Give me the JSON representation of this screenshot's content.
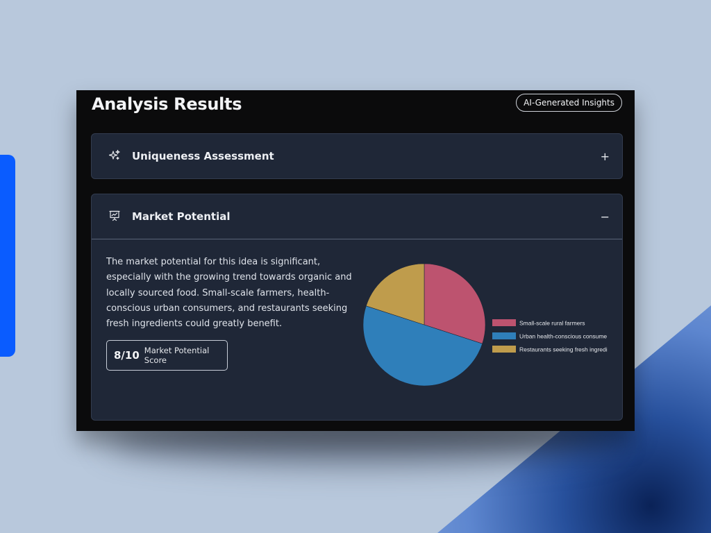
{
  "header": {
    "title": "Analysis Results",
    "badge": "AI-Generated Insights"
  },
  "sections": [
    {
      "title": "Uniqueness Assessment",
      "icon": "sparkles-icon",
      "toggle": "+",
      "expanded": false
    },
    {
      "title": "Market Potential",
      "icon": "presentation-chart-icon",
      "toggle": "−",
      "expanded": true,
      "description": "The market potential for this idea is significant, especially with the growing trend towards organic and locally sourced food. Small-scale farmers, health-conscious urban consumers, and restaurants seeking fresh ingredients could greatly benefit.",
      "score_value": "8/10",
      "score_label": "Market Potential Score"
    }
  ],
  "chart_data": {
    "type": "pie",
    "categories": [
      "Small-scale rural farmers",
      "Urban health-conscious consume",
      "Restaurants seeking fresh ingredi"
    ],
    "values": [
      30,
      50,
      20
    ],
    "colors": [
      "#bd536f",
      "#2f7fba",
      "#bf9c4c"
    ],
    "legend": "right"
  }
}
